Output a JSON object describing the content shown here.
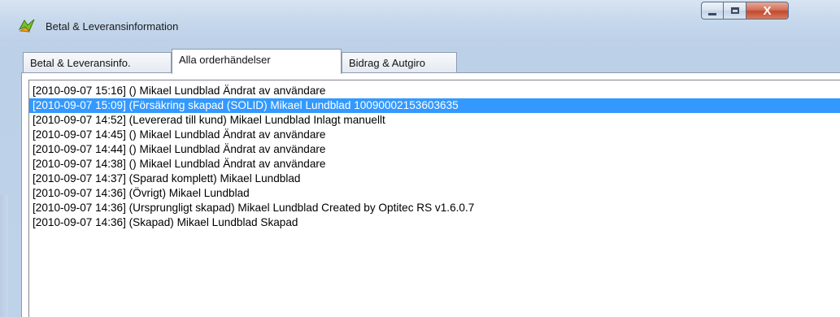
{
  "window": {
    "title": "Betal & Leveransinformation",
    "app_icon": "app-icon",
    "buttons": {
      "minimize": "minimize-icon",
      "maximize": "maximize-icon",
      "close_label": "X"
    }
  },
  "tabs": [
    {
      "label": "Betal & Leveransinfo.",
      "active": false
    },
    {
      "label": "Alla orderhändelser",
      "active": true
    },
    {
      "label": "Bidrag & Autgiro",
      "active": false
    }
  ],
  "events": {
    "selected_index": 1,
    "items": [
      "[2010-09-07 15:16] () Mikael Lundblad Ändrat av användare",
      "[2010-09-07 15:09] (Försäkring skapad (SOLID) Mikael Lundblad 10090002153603635",
      "[2010-09-07 14:52] (Levererad till kund) Mikael Lundblad Inlagt manuellt",
      "[2010-09-07 14:45] () Mikael Lundblad Ändrat av användare",
      "[2010-09-07 14:44] () Mikael Lundblad Ändrat av användare",
      "[2010-09-07 14:38] () Mikael Lundblad Ändrat av användare",
      "[2010-09-07 14:37] (Sparad komplett) Mikael Lundblad",
      "[2010-09-07 14:36] (Övrigt) Mikael Lundblad",
      "[2010-09-07 14:36] (Ursprungligt skapad) Mikael Lundblad Created by Optitec RS v1.6.0.7",
      "[2010-09-07 14:36] (Skapad) Mikael Lundblad Skapad"
    ]
  },
  "colors": {
    "selection": "#3399ff",
    "frame": "#bcd0e8"
  }
}
